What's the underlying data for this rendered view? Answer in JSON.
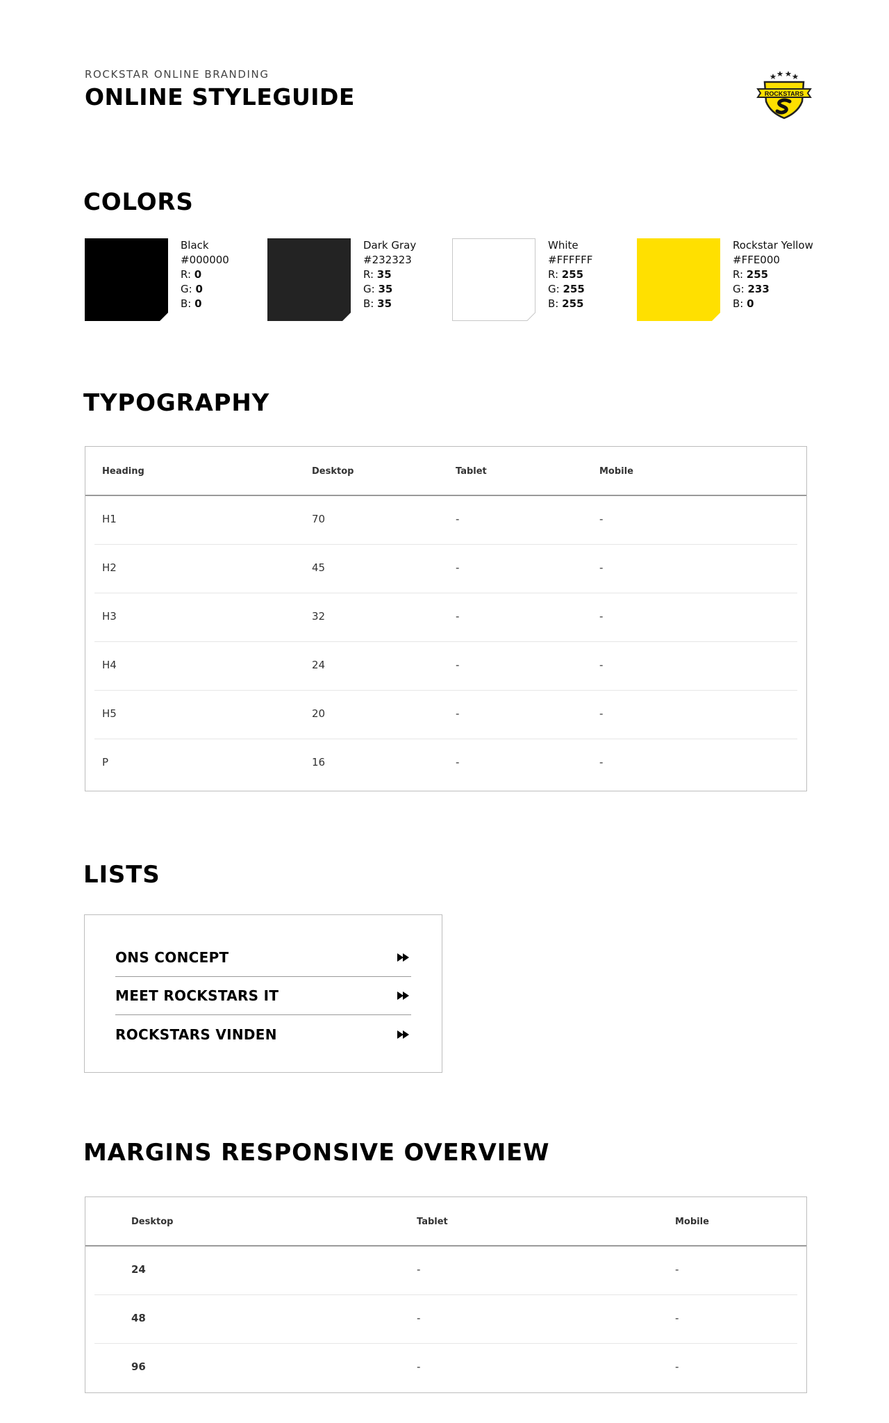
{
  "header": {
    "kicker": "ROCKSTAR ONLINE BRANDING",
    "title": "ONLINE STYLEGUIDE",
    "logo_text": "ROCKSTARS"
  },
  "colors": {
    "title": "COLORS",
    "swatches": [
      {
        "name": "Black",
        "hex": "#000000",
        "r_label": "R:",
        "r": "0",
        "g_label": "G:",
        "g": "0",
        "b_label": "B:",
        "b": "0",
        "fill": "#000000"
      },
      {
        "name": "Dark Gray",
        "hex": "#232323",
        "r_label": "R:",
        "r": "35",
        "g_label": "G:",
        "g": "35",
        "b_label": "B:",
        "b": "35",
        "fill": "#232323"
      },
      {
        "name": "White",
        "hex": "#FFFFFF",
        "r_label": "R:",
        "r": "255",
        "g_label": "G:",
        "g": "255",
        "b_label": "B:",
        "b": "255",
        "fill": "#FFFFFF"
      },
      {
        "name": "Rockstar Yellow",
        "hex": "#FFE000",
        "r_label": "R:",
        "r": "255",
        "g_label": "G:",
        "g": "233",
        "b_label": "B:",
        "b": "0",
        "fill": "#FFE000"
      }
    ]
  },
  "typography": {
    "title": "TYPOGRAPHY",
    "headers": [
      "Heading",
      "Desktop",
      "Tablet",
      "Mobile"
    ],
    "rows": [
      [
        "H1",
        "70",
        "-",
        "-"
      ],
      [
        "H2",
        "45",
        "-",
        "-"
      ],
      [
        "H3",
        "32",
        "-",
        "-"
      ],
      [
        "H4",
        "24",
        "-",
        "-"
      ],
      [
        "H5",
        "20",
        "-",
        "-"
      ],
      [
        "P",
        "16",
        "-",
        "-"
      ]
    ]
  },
  "lists": {
    "title": "LISTS",
    "items": [
      "ONS CONCEPT",
      "MEET ROCKSTARS IT",
      "ROCKSTARS VINDEN"
    ]
  },
  "margins": {
    "title": "MARGINS RESPONSIVE OVERVIEW",
    "headers": [
      "Desktop",
      "Tablet",
      "Mobile"
    ],
    "rows": [
      [
        "24",
        "-",
        "-"
      ],
      [
        "48",
        "-",
        "-"
      ],
      [
        "96",
        "-",
        "-"
      ]
    ]
  }
}
